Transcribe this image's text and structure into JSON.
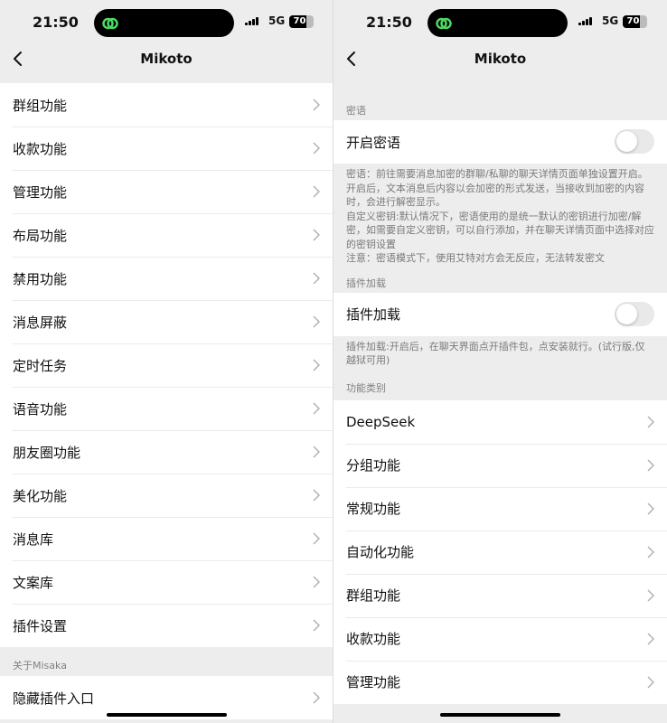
{
  "status": {
    "time": "21:50",
    "network": "5G",
    "battery": "70",
    "battery_level": 0.7
  },
  "left": {
    "title": "Mikoto",
    "menu_items": [
      {
        "label": "群组功能"
      },
      {
        "label": "收款功能"
      },
      {
        "label": "管理功能"
      },
      {
        "label": "布局功能"
      },
      {
        "label": "禁用功能"
      },
      {
        "label": "消息屏蔽"
      },
      {
        "label": "定时任务"
      },
      {
        "label": "语音功能"
      },
      {
        "label": "朋友圈功能"
      },
      {
        "label": "美化功能"
      },
      {
        "label": "消息库"
      },
      {
        "label": "文案库"
      },
      {
        "label": "插件设置"
      }
    ],
    "about_header": "关于Misaka",
    "about_items": [
      {
        "label": "隐藏插件入口"
      }
    ]
  },
  "right": {
    "title": "Mikoto",
    "secret_header": "密语",
    "secret_toggle_label": "开启密语",
    "secret_toggle_on": false,
    "secret_desc": [
      "密语：前往需要消息加密的群聊/私聊的聊天详情页面单独设置开启。开启后，文本消息后内容以会加密的形式发送，当接收到加密的内容时，会进行解密显示。",
      "自定义密钥:默认情况下，密语使用的是统一默认的密钥进行加密/解密，如需要自定义密钥，可以自行添加，并在聊天详情页面中选择对应的密钥设置",
      "注意：密语模式下，使用艾特对方会无反应，无法转发密文"
    ],
    "plugin_header": "插件加载",
    "plugin_toggle_label": "插件加载",
    "plugin_toggle_on": false,
    "plugin_desc": "插件加载:开启后，在聊天界面点开插件包，点安装就行。(试行版,仅越狱可用)",
    "category_header": "功能类别",
    "category_items": [
      {
        "label": "DeepSeek"
      },
      {
        "label": "分组功能"
      },
      {
        "label": "常规功能"
      },
      {
        "label": "自动化功能"
      },
      {
        "label": "群组功能"
      },
      {
        "label": "收款功能"
      },
      {
        "label": "管理功能"
      }
    ]
  }
}
